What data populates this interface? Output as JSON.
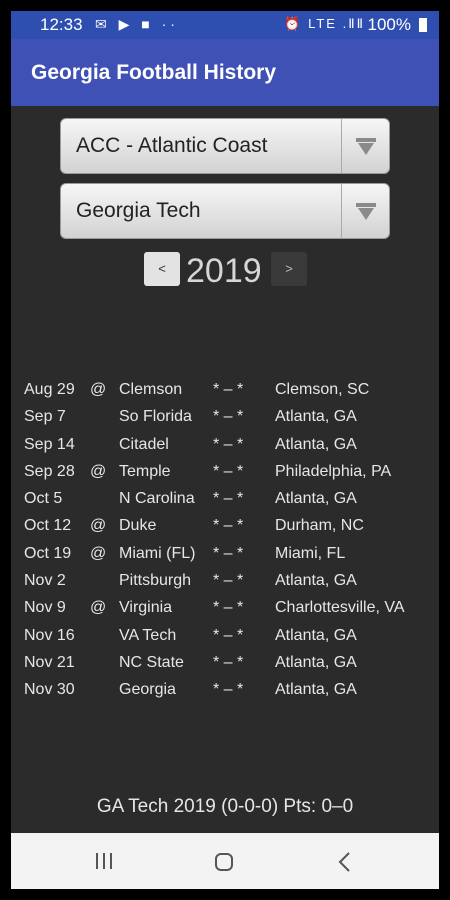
{
  "status": {
    "time": "12:33",
    "left_icons": "✉ ▶ ■ ··",
    "right_icons": "⏰ LTE .ⅡⅡ",
    "battery": "100%"
  },
  "app": {
    "title": "Georgia Football History"
  },
  "conference_select": {
    "value": "ACC - Atlantic Coast"
  },
  "team_select": {
    "value": "Georgia Tech"
  },
  "year_nav": {
    "prev": "<",
    "year": "2019",
    "next": ">"
  },
  "schedule": [
    {
      "date": "Aug 29",
      "at": "@",
      "opponent": "Clemson",
      "score": "* – *",
      "location": "Clemson, SC"
    },
    {
      "date": "Sep 7",
      "at": "",
      "opponent": "So Florida",
      "score": "* – *",
      "location": "Atlanta, GA"
    },
    {
      "date": "Sep 14",
      "at": "",
      "opponent": "Citadel",
      "score": "* – *",
      "location": "Atlanta, GA"
    },
    {
      "date": "Sep 28",
      "at": "@",
      "opponent": "Temple",
      "score": "* – *",
      "location": "Philadelphia, PA"
    },
    {
      "date": "Oct 5",
      "at": "",
      "opponent": "N Carolina",
      "score": "* – *",
      "location": "Atlanta, GA"
    },
    {
      "date": "Oct 12",
      "at": "@",
      "opponent": "Duke",
      "score": "* – *",
      "location": "Durham, NC"
    },
    {
      "date": "Oct 19",
      "at": "@",
      "opponent": "Miami (FL)",
      "score": "* – *",
      "location": "Miami, FL"
    },
    {
      "date": "Nov 2",
      "at": "",
      "opponent": "Pittsburgh",
      "score": "* – *",
      "location": "Atlanta, GA"
    },
    {
      "date": "Nov 9",
      "at": "@",
      "opponent": "Virginia",
      "score": "* – *",
      "location": "Charlottesville, VA"
    },
    {
      "date": "Nov 16",
      "at": "",
      "opponent": "VA Tech",
      "score": "* – *",
      "location": "Atlanta, GA"
    },
    {
      "date": "Nov 21",
      "at": "",
      "opponent": "NC State",
      "score": "* – *",
      "location": "Atlanta, GA"
    },
    {
      "date": "Nov 30",
      "at": "",
      "opponent": "Georgia",
      "score": "* – *",
      "location": "Atlanta, GA"
    }
  ],
  "summary": "GA Tech 2019 (0-0-0) Pts:  0–0",
  "colors": {
    "app_bar": "#3f51b5",
    "status_bar": "#2f4fb0",
    "background": "#2b2b2b",
    "nav_bar": "#f3f3f3"
  }
}
